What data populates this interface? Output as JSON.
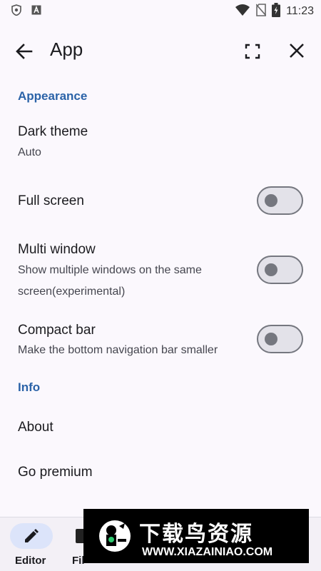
{
  "status_bar": {
    "time": "11:23"
  },
  "top_bar": {
    "title": "App"
  },
  "sections": {
    "appearance_header": "Appearance",
    "info_header": "Info"
  },
  "settings": {
    "dark_theme": {
      "title": "Dark theme",
      "value": "Auto"
    },
    "full_screen": {
      "title": "Full screen",
      "enabled": false
    },
    "multi_window": {
      "title": "Multi window",
      "subtitle_line1": "Show multiple windows on the same",
      "subtitle_line2": "screen(experimental)",
      "enabled": false
    },
    "compact_bar": {
      "title": "Compact bar",
      "subtitle": "Make the bottom navigation bar smaller",
      "enabled": false
    },
    "about": {
      "title": "About"
    },
    "go_premium": {
      "title": "Go premium"
    }
  },
  "bottom_nav": {
    "editor_label": "Editor",
    "files_label": "Fil"
  },
  "watermark": {
    "title": "下载鸟资源",
    "url": "WWW.XIAZAINIAO.COM"
  },
  "colors": {
    "accent": "#2b63a8",
    "background": "#fbf8fd",
    "toggle_track": "#e3e2e9",
    "toggle_outline": "#75777f",
    "nav_pill": "#dce4fa"
  }
}
